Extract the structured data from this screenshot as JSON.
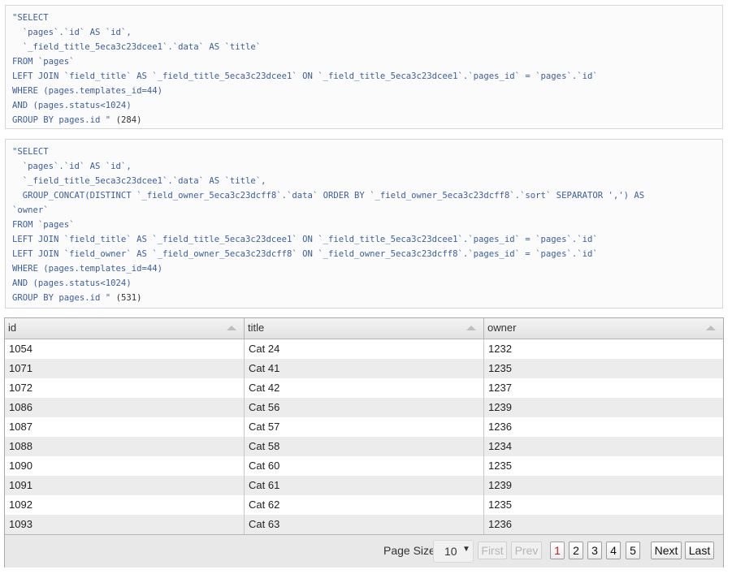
{
  "sql_queries": [
    {
      "lines": [
        "\"SELECT",
        "  `pages`.`id` AS `id`,",
        "  `_field_title_5eca3c23dcee1`.`data` AS `title`",
        "FROM `pages`",
        "LEFT JOIN `field_title` AS `_field_title_5eca3c23dcee1` ON `_field_title_5eca3c23dcee1`.`pages_id` = `pages`.`id`",
        "WHERE (pages.templates_id=44)",
        "AND (pages.status<1024)",
        "GROUP BY pages.id \""
      ],
      "duration": " (284)"
    },
    {
      "lines": [
        "\"SELECT",
        "  `pages`.`id` AS `id`,",
        "  `_field_title_5eca3c23dcee1`.`data` AS `title`,",
        "  GROUP_CONCAT(DISTINCT `_field_owner_5eca3c23dcff8`.`data` ORDER BY `_field_owner_5eca3c23dcff8`.`sort` SEPARATOR ',') AS",
        "`owner`",
        "FROM `pages`",
        "LEFT JOIN `field_title` AS `_field_title_5eca3c23dcee1` ON `_field_title_5eca3c23dcee1`.`pages_id` = `pages`.`id`",
        "LEFT JOIN `field_owner` AS `_field_owner_5eca3c23dcff8` ON `_field_owner_5eca3c23dcff8`.`pages_id` = `pages`.`id`",
        "WHERE (pages.templates_id=44)",
        "AND (pages.status<1024)",
        "GROUP BY pages.id \""
      ],
      "duration": " (531)"
    }
  ],
  "grid": {
    "columns": [
      "id",
      "title",
      "owner"
    ],
    "rows": [
      [
        "1054",
        "Cat 24",
        "1232"
      ],
      [
        "1071",
        "Cat 41",
        "1235"
      ],
      [
        "1072",
        "Cat 42",
        "1237"
      ],
      [
        "1086",
        "Cat 56",
        "1239"
      ],
      [
        "1087",
        "Cat 57",
        "1236"
      ],
      [
        "1088",
        "Cat 58",
        "1234"
      ],
      [
        "1090",
        "Cat 60",
        "1235"
      ],
      [
        "1091",
        "Cat 61",
        "1239"
      ],
      [
        "1092",
        "Cat 62",
        "1235"
      ],
      [
        "1093",
        "Cat 63",
        "1236"
      ]
    ]
  },
  "pager": {
    "page_size_label": "Page Size",
    "page_size_value": "10",
    "first_label": "First",
    "prev_label": "Prev",
    "pages": [
      "1",
      "2",
      "3",
      "4",
      "5"
    ],
    "current_page": "1",
    "next_label": "Next",
    "last_label": "Last"
  },
  "colors": {
    "sql_text": "#3a5fa0",
    "current_page": "#d11a1a",
    "row_alt": "#ececec"
  }
}
